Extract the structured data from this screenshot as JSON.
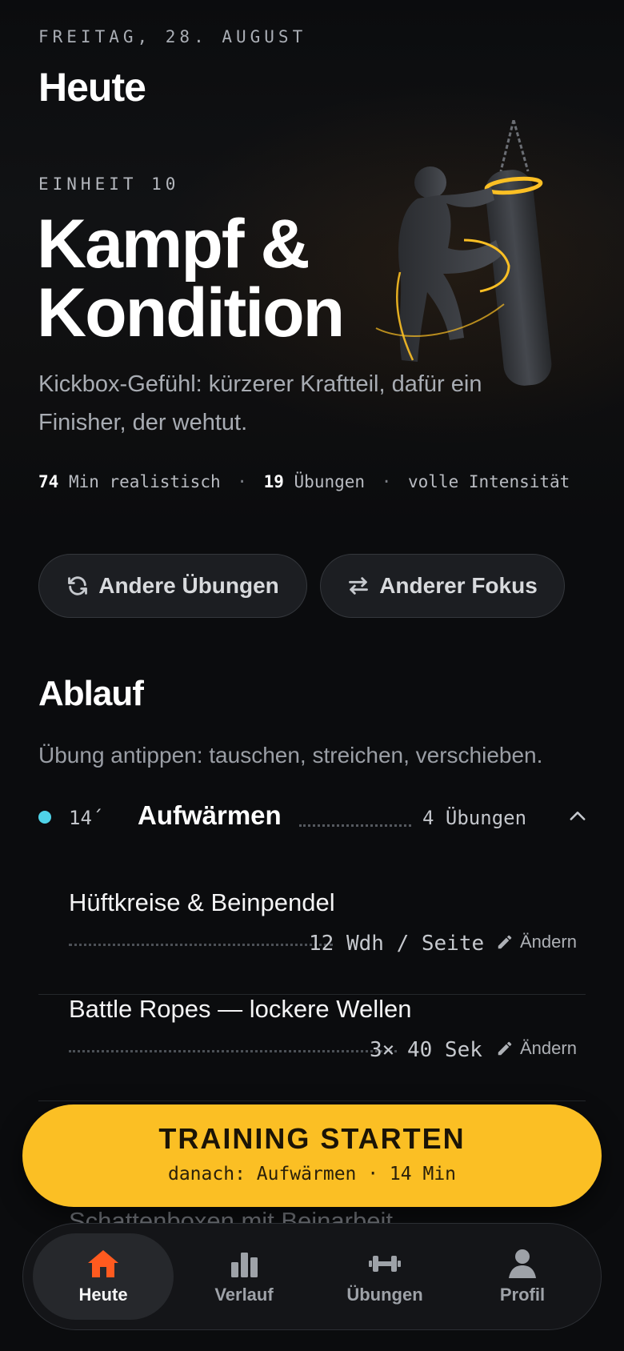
{
  "header": {
    "date": "FREITAG, 28. AUGUST",
    "title": "Heute"
  },
  "workout": {
    "unit": "EINHEIT 10",
    "title_line1": "Kampf &",
    "title_line2": "Kondition",
    "description": "Kickbox-Gefühl: kürzerer Kraftteil, dafür ein Finisher, der wehtut.",
    "stats": {
      "minutes": "74",
      "minutes_label": "Min realistisch",
      "exercises": "19",
      "exercises_label": "Übungen",
      "intensity": "volle Intensität",
      "separator": "·"
    }
  },
  "actions": {
    "other_exercises": "Andere Übungen",
    "other_focus": "Anderer Fokus"
  },
  "plan": {
    "title": "Ablauf",
    "hint": "Übung antippen: tauschen, streichen, verschieben.",
    "phase": {
      "duration": "14´",
      "name": "Aufwärmen",
      "count": "4 Übungen",
      "color": "#4fd3e8"
    },
    "exercises": [
      {
        "name": "Hüftkreise & Beinpendel",
        "value": "12 Wdh / Seite",
        "edit": "Ändern"
      },
      {
        "name": "Battle Ropes — lockere Wellen",
        "value": "3× 40 Sek",
        "edit": "Ändern"
      },
      {
        "name": "Schattenboxen mit Beinarbeit"
      }
    ]
  },
  "cta": {
    "title": "TRAINING STARTEN",
    "subtitle": "danach: Aufwärmen · 14 Min",
    "color": "#fbbf24"
  },
  "tabs": [
    {
      "label": "Heute",
      "icon": "home-icon",
      "active": true,
      "color": "#ff5a1f"
    },
    {
      "label": "Verlauf",
      "icon": "bar-chart-icon"
    },
    {
      "label": "Übungen",
      "icon": "dumbbell-icon"
    },
    {
      "label": "Profil",
      "icon": "user-icon"
    }
  ]
}
